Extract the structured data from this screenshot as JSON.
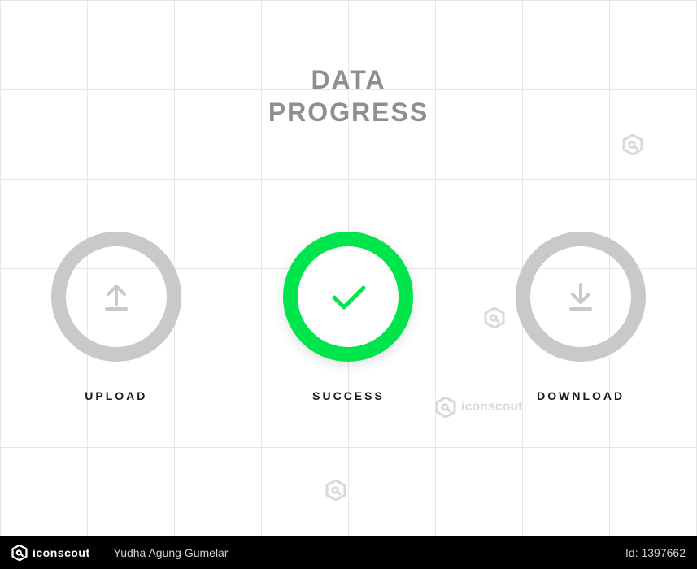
{
  "title_line1": "DATA",
  "title_line2": "PROGRESS",
  "items": [
    {
      "label": "UPLOAD"
    },
    {
      "label": "SUCCESS"
    },
    {
      "label": "DOWNLOAD"
    }
  ],
  "watermark_text": "iconscout",
  "footer": {
    "brand": "iconscout",
    "author": "Yudha Agung Gumelar",
    "id_label": "Id",
    "id_value": "1397662"
  }
}
